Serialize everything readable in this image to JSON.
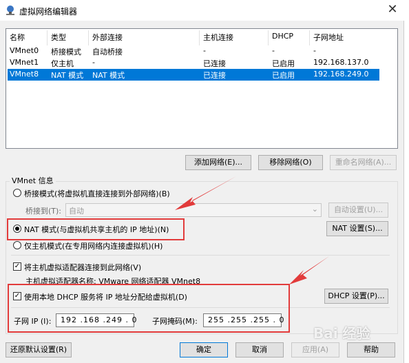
{
  "window": {
    "title": "虚拟网络编辑器",
    "close_glyph": "✕"
  },
  "table": {
    "headers": [
      "名称",
      "类型",
      "外部连接",
      "主机连接",
      "DHCP",
      "子网地址"
    ],
    "rows": [
      {
        "name": "VMnet0",
        "type": "桥接模式",
        "external": "自动桥接",
        "host": "-",
        "dhcp": "-",
        "subnet": "-"
      },
      {
        "name": "VMnet1",
        "type": "仅主机",
        "external": "-",
        "host": "已连接",
        "dhcp": "已启用",
        "subnet": "192.168.137.0"
      },
      {
        "name": "VMnet8",
        "type": "NAT 模式",
        "external": "NAT 模式",
        "host": "已连接",
        "dhcp": "已启用",
        "subnet": "192.168.249.0"
      }
    ],
    "selected_row": 2
  },
  "table_buttons": {
    "add": "添加网络(E)...",
    "remove": "移除网络(O)",
    "rename": "重命名网络(A)..."
  },
  "vmnet_info": {
    "title": "VMnet 信息",
    "bridged_label": "桥接模式(将虚拟机直接连接到外部网络)(B)",
    "bridge_to_label": "桥接到(T):",
    "bridge_to_value": "自动",
    "auto_settings": "自动设置(U)...",
    "nat_label": "NAT 模式(与虚拟机共享主机的 IP 地址)(N)",
    "nat_settings": "NAT 设置(S)...",
    "hostonly_label": "仅主机模式(在专用网络内连接虚拟机)(H)",
    "connect_adapter_label": "将主机虚拟适配器连接到此网络(V)",
    "adapter_name_label": "主机虚拟适配器名称: VMware 网络适配器 VMnet8",
    "dhcp_label": "使用本地 DHCP 服务将 IP 地址分配给虚拟机(D)",
    "dhcp_settings": "DHCP 设置(P)...",
    "subnet_ip_label": "子网 IP (I):",
    "subnet_ip_value": "192 .168 .249 . 0",
    "subnet_mask_label": "子网掩码(M):",
    "subnet_mask_value": "255 .255 .255 . 0",
    "selected_mode": "nat",
    "connect_adapter_checked": true,
    "dhcp_checked": true
  },
  "footer": {
    "restore_defaults": "还原默认设置(R)",
    "ok": "确定",
    "cancel": "取消",
    "apply": "应用(A)",
    "help": "帮助"
  },
  "watermark": "Bai 经验",
  "colors": {
    "selection": "#0078d7",
    "annotation": "#e23b3b"
  }
}
